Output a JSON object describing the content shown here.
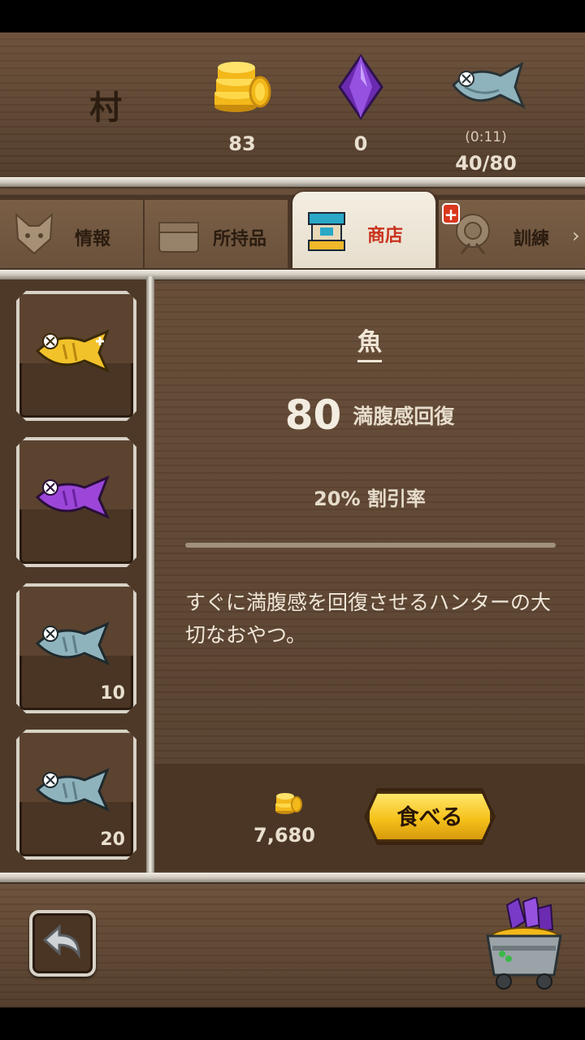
{
  "header": {
    "title": "村",
    "gold": "83",
    "gems": "0",
    "fish_timer": "(0:11)",
    "fish_stamina": "40/80"
  },
  "tabs": [
    {
      "label": "情報",
      "icon": "cat-icon"
    },
    {
      "label": "所持品",
      "icon": "chest-icon"
    },
    {
      "label": "商店",
      "icon": "shop-icon",
      "active": true
    },
    {
      "label": "訓練",
      "icon": "training-icon",
      "badge": "+"
    }
  ],
  "items": [
    {
      "name": "gold fish",
      "count": ""
    },
    {
      "name": "purple fish",
      "count": ""
    },
    {
      "name": "blue fish",
      "count": "10"
    },
    {
      "name": "blue fish",
      "count": "20"
    }
  ],
  "detail": {
    "title": "魚",
    "amount": "80",
    "effect": "満腹感回復",
    "discount": "20% 割引率",
    "description": "すぐに満腹感を回復させるハンターの大切なおやつ。"
  },
  "purchase": {
    "price": "7,680",
    "button": "食べる"
  },
  "colors": {
    "wood": "#5a4330",
    "button_gold": "#f5c21b",
    "active_tab_text": "#c8321e"
  }
}
